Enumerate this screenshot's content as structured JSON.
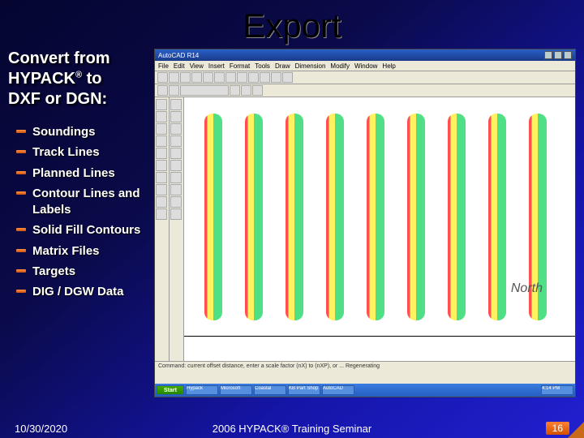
{
  "title": "Export",
  "subtitle_l1": "Convert from",
  "subtitle_l2a": "HYPACK",
  "subtitle_reg": "®",
  "subtitle_l2b": " to",
  "subtitle_l3": "DXF or DGN:",
  "bullets": [
    "Soundings",
    "Track Lines",
    "Planned Lines",
    "Contour Lines and Labels",
    "Solid Fill Contours",
    "Matrix Files",
    "Targets",
    "DIG / DGW Data"
  ],
  "footer": {
    "date": "10/30/2020",
    "center": "2006 HYPACK® Training Seminar",
    "page": "16"
  },
  "app": {
    "title": "AutoCAD R14",
    "menus": [
      "File",
      "Edit",
      "View",
      "Insert",
      "Format",
      "Tools",
      "Draw",
      "Dimension",
      "Modify",
      "Window",
      "Help"
    ],
    "north": "North",
    "cmd": "Command: current offset distance, enter a scale factor (nX) to (nXP), or ...   Regenerating",
    "taskbar": {
      "start": "Start",
      "items": [
        "Hypack",
        "Microsoft",
        "Coastal",
        "KB Part Shop",
        "AutoCAD"
      ],
      "clock": "4:14 PM"
    }
  }
}
